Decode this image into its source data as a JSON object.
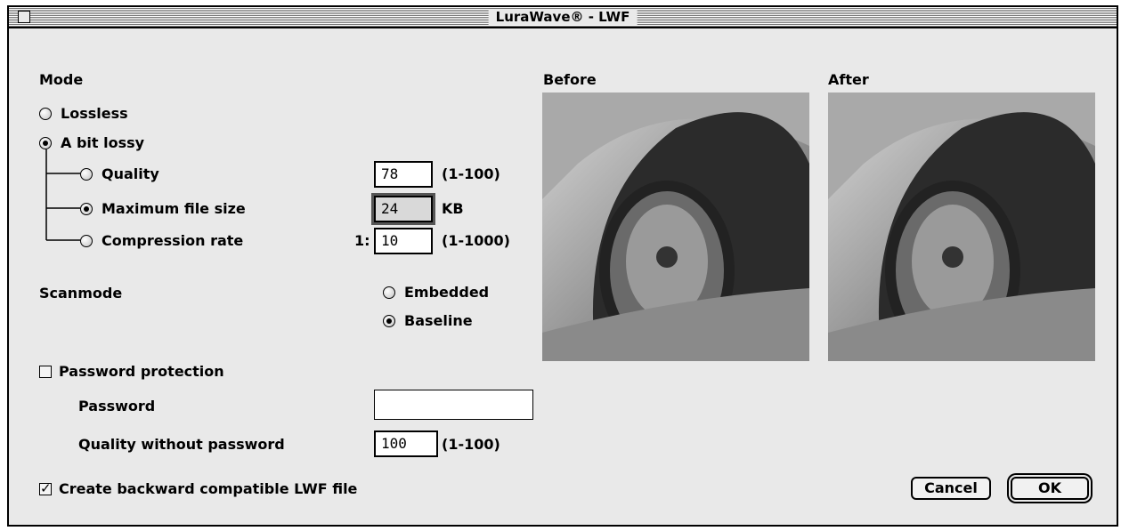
{
  "window": {
    "title": "LuraWave® - LWF"
  },
  "mode": {
    "heading": "Mode",
    "lossless_label": "Lossless",
    "bit_lossy_label": "A bit lossy",
    "options": {
      "quality": {
        "label": "Quality",
        "value": "78",
        "range": "(1-100)"
      },
      "max_file_size": {
        "label": "Maximum file size",
        "value": "24",
        "unit": "KB"
      },
      "compression_rate": {
        "label": "Compression rate",
        "prefix": "1:",
        "value": "10",
        "range": "(1-1000)"
      }
    }
  },
  "scanmode": {
    "heading": "Scanmode",
    "embedded_label": "Embedded",
    "baseline_label": "Baseline"
  },
  "password": {
    "checkbox_label": "Password protection",
    "password_label": "Password",
    "password_value": "",
    "quality_label": "Quality without password",
    "quality_value": "100",
    "quality_range": "(1-100)"
  },
  "backward_compat_label": "Create backward compatible LWF file",
  "preview": {
    "before_label": "Before",
    "after_label": "After"
  },
  "buttons": {
    "cancel": "Cancel",
    "ok": "OK"
  }
}
